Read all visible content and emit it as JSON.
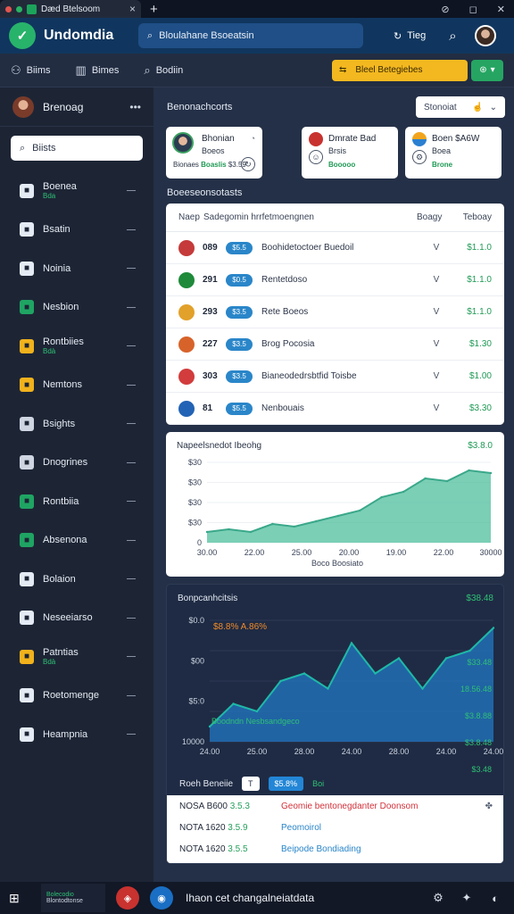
{
  "browser": {
    "tab_title": "Dæd Btelsoom",
    "controls": [
      "⊘",
      "◻",
      "✕"
    ]
  },
  "header": {
    "app_title": "Undomdia",
    "search_text": "Bloulahane Bsoeatsin",
    "action_label": "Tieg"
  },
  "toolbar": {
    "items": [
      {
        "label": "Biims",
        "icon": "users-icon"
      },
      {
        "label": "Bimes",
        "icon": "columns-icon"
      },
      {
        "label": "Bodiin",
        "icon": "search-icon"
      }
    ],
    "alert_text": "Bleel Betegiebes"
  },
  "sidebar": {
    "user_name": "Brenoag",
    "search_placeholder": "Biists",
    "items": [
      {
        "label": "Boenea",
        "sub": "Bda",
        "icon": "puzzle-icon",
        "color": "#e5ebf4"
      },
      {
        "label": "Bsatin",
        "sub": "",
        "icon": "person-icon",
        "color": "#e5ebf4"
      },
      {
        "label": "Noinia",
        "sub": "",
        "icon": "bell-icon",
        "color": "#e5ebf4"
      },
      {
        "label": "Nesbion",
        "sub": "",
        "icon": "runner-icon",
        "color": "#1fa463"
      },
      {
        "label": "Rontbiies",
        "sub": "Bdà",
        "icon": "grid-icon",
        "color": "#f1b21c"
      },
      {
        "label": "Nemtons",
        "sub": "",
        "icon": "box-icon",
        "color": "#f1b21c"
      },
      {
        "label": "Bsights",
        "sub": "",
        "icon": "chart-icon",
        "color": "#cfd6e2"
      },
      {
        "label": "Dnogrines",
        "sub": "",
        "icon": "upload-icon",
        "color": "#cfd6e2"
      },
      {
        "label": "Rontbiia",
        "sub": "",
        "icon": "sheet-icon",
        "color": "#1fa463"
      },
      {
        "label": "Absenona",
        "sub": "",
        "icon": "circle-q-icon",
        "color": "#1fa463"
      },
      {
        "label": "Bolaion",
        "sub": "",
        "icon": "shield-icon",
        "color": "#e5ebf4"
      },
      {
        "label": "Neseeiarso",
        "sub": "",
        "icon": "mail-icon",
        "color": "#e5ebf4"
      },
      {
        "label": "Patntias",
        "sub": "Bdà",
        "icon": "folder-icon",
        "color": "#f1b21c"
      },
      {
        "label": "Roetomenge",
        "sub": "",
        "icon": "gear-icon",
        "color": "#e5ebf4"
      },
      {
        "label": "Heampnia",
        "sub": "",
        "icon": "dots-icon",
        "color": "#e5ebf4"
      }
    ]
  },
  "main": {
    "section_title": "Benonachcorts",
    "sort_label": "Stonoiat",
    "cards": [
      {
        "title": "Bhonian",
        "sub": "Boeos",
        "stat_a": "Bionaes",
        "stat_b": "Boaslis",
        "stat_c": "$3.59"
      },
      {
        "title": "Dmrate Bad",
        "sub": "Brsis",
        "stat_a": "",
        "stat_b": "Booooo",
        "stat_c": ""
      },
      {
        "title": "Boen $A6W",
        "sub": "Boea",
        "stat_a": "",
        "stat_b": "Brone",
        "stat_c": ""
      }
    ],
    "table_title": "Boeeseonsotasts",
    "table": {
      "headers": [
        "Naep",
        "Sadegomin hrrfetmoengnen",
        "Boagy",
        "Teboay"
      ],
      "rows": [
        {
          "num": "089",
          "badge": "$5.5",
          "name": "Boohidetoctoer Buedoil",
          "v": "V",
          "amt": "$1.1.0",
          "color": "#c53a3a"
        },
        {
          "num": "291",
          "badge": "$0.5",
          "name": "Rentetdoso",
          "v": "V",
          "amt": "$1.1.0",
          "color": "#1f8a3a"
        },
        {
          "num": "293",
          "badge": "$3.5",
          "name": "Rete Boeos",
          "v": "V",
          "amt": "$1.1.0",
          "color": "#e2a12a"
        },
        {
          "num": "227",
          "badge": "$3.5",
          "name": "Brog Pocosia",
          "v": "V",
          "amt": "$1.30",
          "color": "#d8632a"
        },
        {
          "num": "303",
          "badge": "$3.5",
          "name": "Bianeodedrsbtfid Toisbe",
          "v": "V",
          "amt": "$1.00",
          "color": "#d23c3c"
        },
        {
          "num": "81",
          "badge": "$5.5",
          "name": "Nenbouais",
          "v": "V",
          "amt": "$3.30",
          "color": "#2363b5"
        }
      ]
    }
  },
  "chart_data": [
    {
      "type": "area",
      "title": "Napeelsnedot Ibeohg",
      "value_label": "$3.8.0",
      "x_ticks": [
        "30.00",
        "22.00",
        "25.00",
        "20.00",
        "19.00",
        "22.00",
        "30000"
      ],
      "y_ticks": [
        "0",
        "$30",
        "$30",
        "$30",
        "$30"
      ],
      "xlabel": "Boco Boosiato",
      "x": [
        0,
        1,
        2,
        3,
        4,
        5,
        6,
        7,
        8,
        9,
        10,
        11,
        12,
        13
      ],
      "values": [
        4,
        5,
        4,
        7,
        6,
        8,
        10,
        12,
        17,
        19,
        24,
        23,
        27,
        26
      ],
      "ylim": [
        0,
        30
      ]
    },
    {
      "type": "area",
      "title": "Bonpcanhcitsis",
      "value_label": "$38.48",
      "annotation": "$8.8% A.86%",
      "series_label": "Boodndn Nesbsandgeco",
      "x_ticks": [
        "24.00",
        "25.00",
        "28.00",
        "24.00",
        "28.00",
        "24.00",
        "24.00"
      ],
      "y_ticks": [
        "10000",
        "$5:0",
        "$00",
        "$0.0"
      ],
      "right_labels": [
        "$33.48",
        "18.56.48",
        "$3.8.88",
        "$3.8.48",
        "$3.48"
      ],
      "x": [
        0,
        1,
        2,
        3,
        4,
        5,
        6,
        7,
        8,
        9,
        10,
        11,
        12
      ],
      "values": [
        2,
        5,
        4,
        8,
        9,
        7,
        13,
        9,
        11,
        7,
        11,
        12,
        15
      ],
      "ylim": [
        0,
        16
      ]
    }
  ],
  "lower": {
    "filter_label": "Roeh Beneiie",
    "chip_a": "T",
    "chip_b": "$5.8%",
    "chip_c": "Boi",
    "rows": [
      {
        "code": "NOSA B600",
        "code_val": "3.5.3",
        "desc": "Geomie bentonegdanter Doonsom",
        "end": "✤",
        "desc_color": "red"
      },
      {
        "code": "NOTA 1620",
        "code_val": "3.5.9",
        "desc": "Peomoirol",
        "end": "",
        "desc_color": "blue"
      },
      {
        "code": "NOTA 1620",
        "code_val": "3.5.5",
        "desc": "Beipode Bondiading",
        "end": "",
        "desc_color": "blue"
      }
    ]
  },
  "taskbar": {
    "app_line1": "Bolecodio",
    "app_line2": "Blontodtonse",
    "center_text": "Ihaon cet changalneiatdata"
  }
}
